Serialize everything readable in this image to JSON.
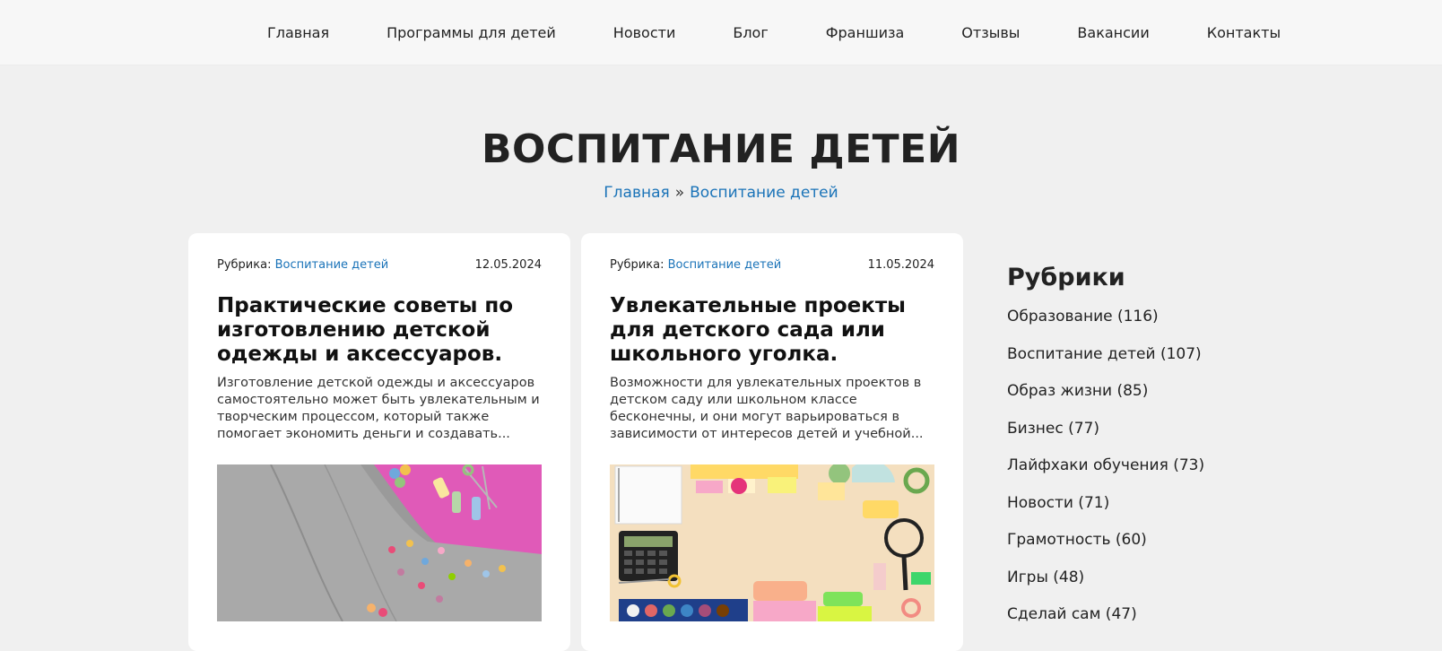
{
  "nav": {
    "items": [
      "Главная",
      "Программы для детей",
      "Новости",
      "Блог",
      "Франшиза",
      "Отзывы",
      "Вакансии",
      "Контакты"
    ]
  },
  "page": {
    "title": "ВОСПИТАНИЕ ДЕТЕЙ"
  },
  "breadcrumb": {
    "home": "Главная",
    "separator": "»",
    "current": "Воспитание детей"
  },
  "posts": [
    {
      "category_label": "Рубрика:",
      "category": "Воспитание детей",
      "date": "12.05.2024",
      "title": "Практические советы по изготовлению детской одежды и аксессуаров.",
      "excerpt": "Изготовление детской одежды и аксессуаров самостоятельно может быть увлекательным и творческим процессом, который также помогает экономить деньги и создавать...",
      "image": "sweater-with-pompoms-thread-scissors"
    },
    {
      "category_label": "Рубрика:",
      "category": "Воспитание детей",
      "date": "11.05.2024",
      "title": "Увлекательные проекты для детского сада или школьного уголка.",
      "excerpt": "Возможности для увлекательных проектов в детском саду или школьном классе бесконечны, и они могут варьироваться в зависимости от интересов детей и учебной...",
      "image": "school-supplies-flatlay"
    }
  ],
  "sidebar": {
    "title": "Рубрики",
    "categories": [
      "Образование (116)",
      "Воспитание детей (107)",
      "Образ жизни (85)",
      "Бизнес (77)",
      "Лайфхаки обучения (73)",
      "Новости (71)",
      "Грамотность (60)",
      "Игры (48)",
      "Сделай сам (47)"
    ]
  },
  "colors": {
    "link": "#1a73b8",
    "background": "#f0f0f0",
    "card": "#ffffff"
  }
}
